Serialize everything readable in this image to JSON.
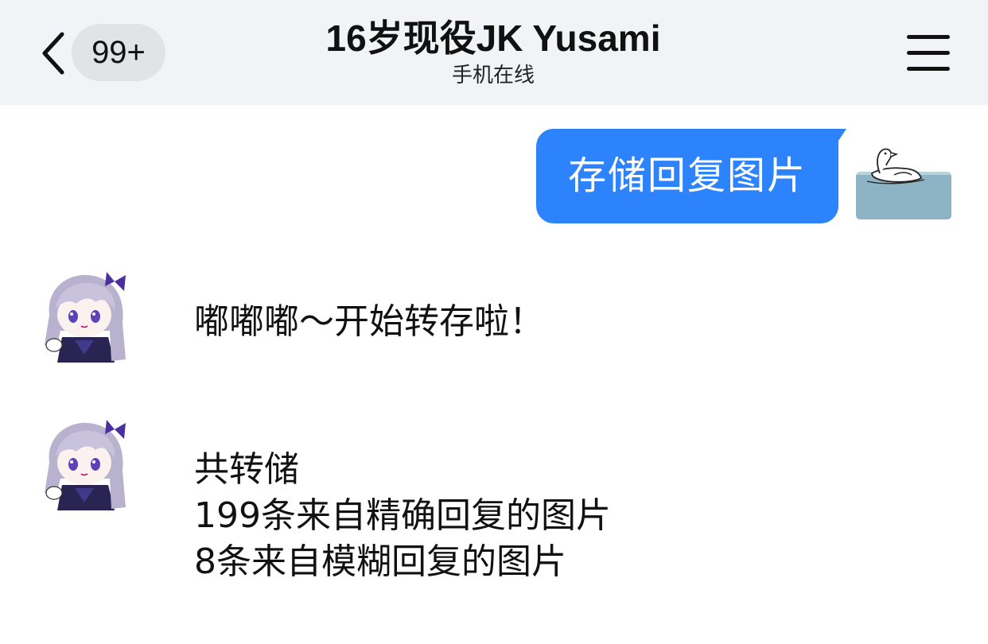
{
  "header": {
    "back_icon": "chevron-left-icon",
    "unread_badge": "99+",
    "title": "16岁现役JK Yusami",
    "subtitle": "手机在线",
    "menu_icon": "hamburger-menu-icon"
  },
  "messages": [
    {
      "direction": "outgoing",
      "sender_avatar": "duck-avatar",
      "text": "存储回复图片"
    },
    {
      "direction": "incoming",
      "sender_avatar": "anime-girl-avatar",
      "text": "嘟嘟嘟～开始转存啦！"
    },
    {
      "direction": "incoming",
      "sender_avatar": "anime-girl-avatar",
      "lines": [
        "共转储",
        "199条来自精确回复的图片",
        "8条来自模糊回复的图片"
      ]
    }
  ],
  "colors": {
    "header_bg": "#f2f3f6",
    "outgoing_bubble": "#2d83fb",
    "badge_bg": "#e2e3e7"
  }
}
